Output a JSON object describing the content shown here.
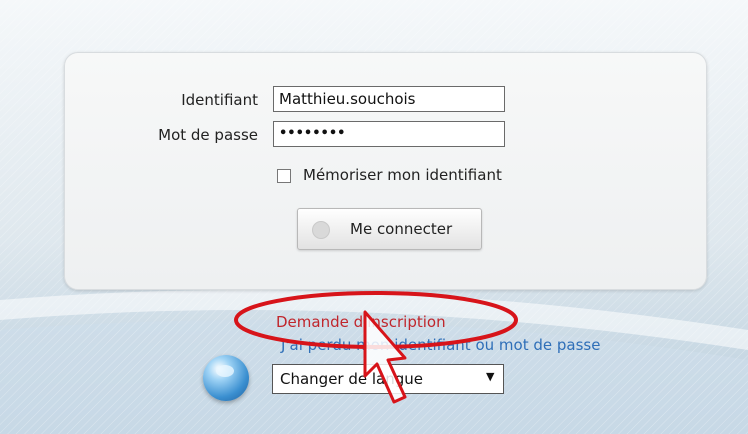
{
  "login": {
    "identifier_label": "Identifiant",
    "identifier_value": "Matthieu.souchois",
    "password_label": "Mot de passe",
    "password_value": "••••••••",
    "remember_label": "Mémoriser mon identifiant",
    "remember_checked": false,
    "connect_label": "Me connecter"
  },
  "links": {
    "register": "Demande d'inscription",
    "forgot": "J'ai perdu mon identifiant ou mot de passe"
  },
  "language": {
    "selected": "Changer de langue"
  },
  "colors": {
    "register_link": "#c0262c",
    "forgot_link": "#2f6fb8",
    "annotation": "#d7141a"
  },
  "icons": {
    "button_icon": "power-icon",
    "language_icon": "globe-icon",
    "annotation": "arrow-cursor-icon"
  }
}
